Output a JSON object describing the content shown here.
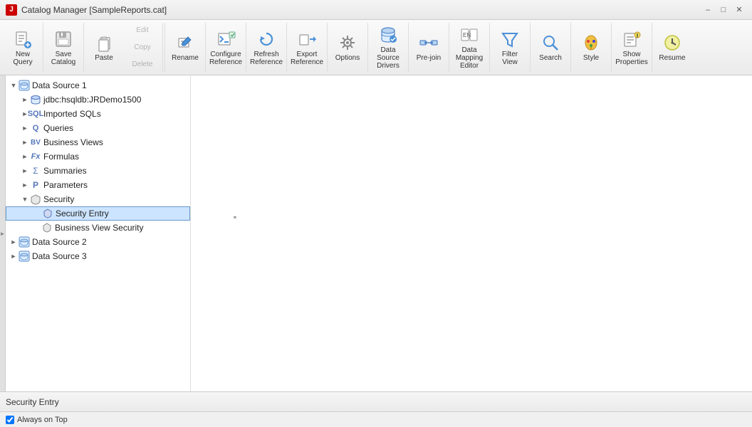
{
  "window": {
    "title": "Catalog Manager [SampleReports.cat]",
    "title_icon": "J"
  },
  "toolbar": {
    "groups": [
      {
        "id": "query",
        "buttons": [
          {
            "id": "new-query",
            "label": "New\nQuery",
            "icon": "new-query",
            "disabled": false
          }
        ]
      },
      {
        "id": "catalog",
        "buttons": [
          {
            "id": "save-catalog",
            "label": "Save\nCatalog",
            "icon": "save",
            "disabled": false
          }
        ]
      },
      {
        "id": "clipboard",
        "buttons": [
          {
            "id": "paste",
            "label": "Paste",
            "icon": "paste",
            "disabled": false
          }
        ],
        "small_buttons": [
          {
            "id": "edit",
            "label": "Edit",
            "disabled": true
          },
          {
            "id": "copy",
            "label": "Copy",
            "disabled": true
          },
          {
            "id": "delete",
            "label": "Delete",
            "disabled": true
          }
        ]
      },
      {
        "id": "rename",
        "buttons": [
          {
            "id": "rename",
            "label": "Rename",
            "icon": "rename",
            "disabled": false
          }
        ]
      },
      {
        "id": "configure",
        "buttons": [
          {
            "id": "configure-reference",
            "label": "Configure\nReference",
            "icon": "configure",
            "disabled": false
          }
        ]
      },
      {
        "id": "refresh",
        "buttons": [
          {
            "id": "refresh-reference",
            "label": "Refresh\nReference",
            "icon": "refresh",
            "disabled": false
          }
        ]
      },
      {
        "id": "export",
        "buttons": [
          {
            "id": "export-reference",
            "label": "Export\nReference",
            "icon": "export",
            "disabled": false
          }
        ]
      },
      {
        "id": "options",
        "buttons": [
          {
            "id": "options",
            "label": "Options",
            "icon": "options",
            "disabled": false
          }
        ]
      },
      {
        "id": "datasource",
        "buttons": [
          {
            "id": "data-source-drivers",
            "label": "Data Source\nDrivers",
            "icon": "datasource",
            "disabled": false
          }
        ]
      },
      {
        "id": "prejoin",
        "buttons": [
          {
            "id": "pre-join",
            "label": "Pre-join",
            "icon": "prejoin",
            "disabled": false
          }
        ]
      },
      {
        "id": "datamapping",
        "buttons": [
          {
            "id": "data-mapping-editor",
            "label": "Data Mapping\nEditor",
            "icon": "datamapping",
            "disabled": false
          }
        ]
      },
      {
        "id": "filter",
        "buttons": [
          {
            "id": "filter-view",
            "label": "Filter\nView",
            "icon": "filter",
            "disabled": false
          }
        ]
      },
      {
        "id": "search",
        "buttons": [
          {
            "id": "search",
            "label": "Search",
            "icon": "search",
            "disabled": false
          }
        ]
      },
      {
        "id": "style",
        "buttons": [
          {
            "id": "style",
            "label": "Style",
            "icon": "style",
            "disabled": false
          }
        ]
      },
      {
        "id": "show",
        "buttons": [
          {
            "id": "show-properties",
            "label": "Show\nProperties",
            "icon": "show",
            "disabled": false
          }
        ]
      },
      {
        "id": "resume",
        "buttons": [
          {
            "id": "resume",
            "label": "Resume",
            "icon": "resume",
            "disabled": false
          }
        ]
      }
    ]
  },
  "tree": {
    "items": [
      {
        "id": "ds1",
        "label": "Data Source 1",
        "level": 0,
        "expanded": true,
        "icon": "datasource-folder",
        "has_expand": true
      },
      {
        "id": "jdbc",
        "label": "jdbc:hsqldb:JRDemo1500",
        "level": 1,
        "expanded": false,
        "icon": "db",
        "has_expand": true
      },
      {
        "id": "imported-sqls",
        "label": "Imported SQLs",
        "level": 1,
        "expanded": false,
        "icon": "sql",
        "has_expand": true
      },
      {
        "id": "queries",
        "label": "Queries",
        "level": 1,
        "expanded": false,
        "icon": "query",
        "has_expand": true
      },
      {
        "id": "business-views",
        "label": "Business Views",
        "level": 1,
        "expanded": false,
        "icon": "bv",
        "has_expand": true
      },
      {
        "id": "formulas",
        "label": "Formulas",
        "level": 1,
        "expanded": false,
        "icon": "fx",
        "has_expand": true
      },
      {
        "id": "summaries",
        "label": "Summaries",
        "level": 1,
        "expanded": false,
        "icon": "sigma",
        "has_expand": true
      },
      {
        "id": "parameters",
        "label": "Parameters",
        "level": 1,
        "expanded": false,
        "icon": "param",
        "has_expand": true
      },
      {
        "id": "security",
        "label": "Security",
        "level": 1,
        "expanded": true,
        "icon": "shield",
        "has_expand": true
      },
      {
        "id": "security-entry",
        "label": "Security Entry",
        "level": 2,
        "expanded": false,
        "icon": "shield-sm",
        "has_expand": false,
        "selected": true
      },
      {
        "id": "bv-security",
        "label": "Business View Security",
        "level": 2,
        "expanded": false,
        "icon": "shield-sm",
        "has_expand": false
      },
      {
        "id": "ds2",
        "label": "Data Source 2",
        "level": 0,
        "expanded": false,
        "icon": "datasource-folder",
        "has_expand": true
      },
      {
        "id": "ds3",
        "label": "Data Source 3",
        "level": 0,
        "expanded": false,
        "icon": "datasource-folder",
        "has_expand": true
      }
    ]
  },
  "status_bar": {
    "text": "Security Entry"
  },
  "bottom_bar": {
    "always_on_top_label": "Always on Top",
    "always_on_top_checked": true
  }
}
